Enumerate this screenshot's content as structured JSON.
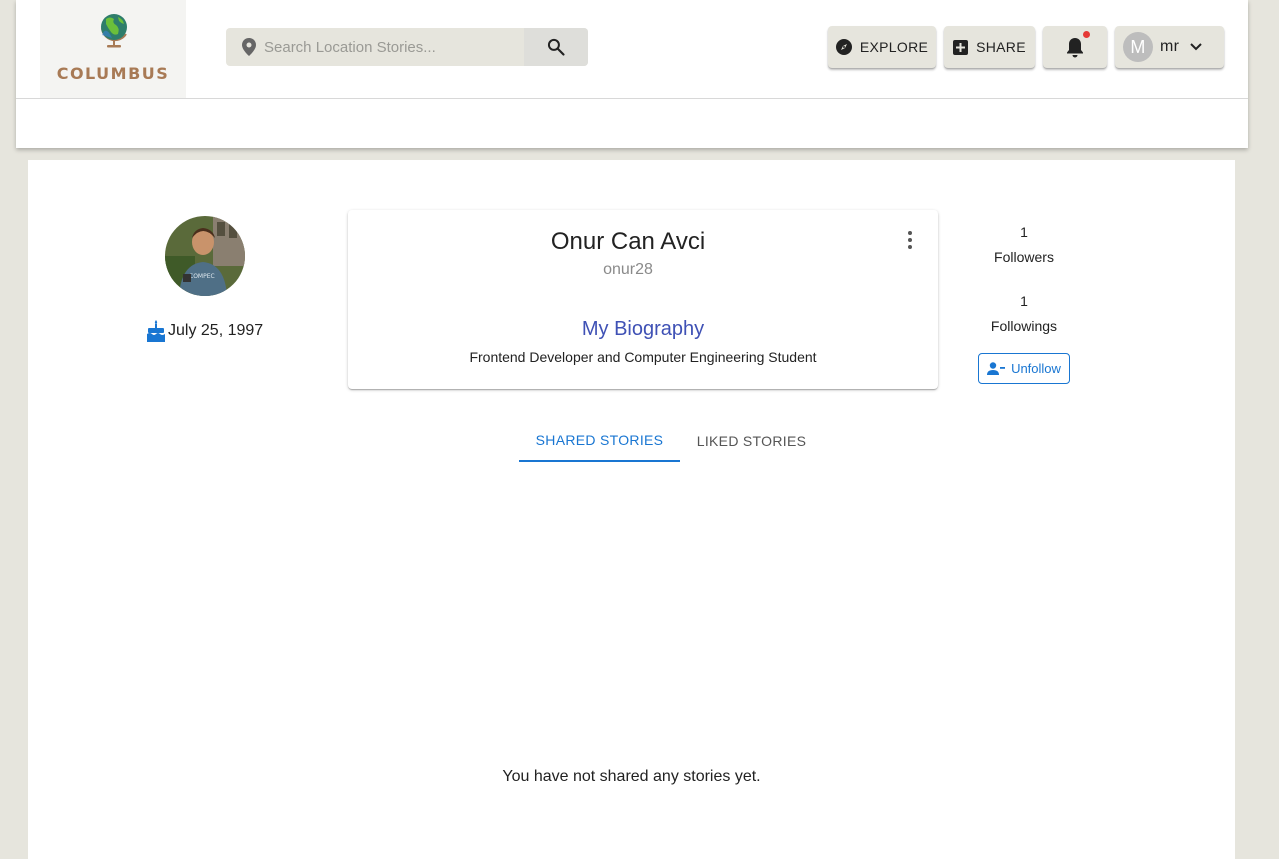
{
  "header": {
    "logo_text": "COLUMBUS",
    "search": {
      "placeholder": "Search Location Stories..."
    },
    "buttons": {
      "explore": "EXPLORE",
      "share": "SHARE"
    },
    "user": {
      "avatar_letter": "M",
      "name": "mr"
    },
    "icons": {
      "pin": "location-pin-icon",
      "search": "search-icon",
      "explore": "compass-icon",
      "share": "add-box-icon",
      "notifications": "bell-icon",
      "dropdown": "chevron-down-icon"
    }
  },
  "profile": {
    "birthday": "July 25, 1997",
    "full_name": "Onur Can Avci",
    "username": "onur28",
    "bio_title": "My Biography",
    "bio_text": "Frontend Developer and Computer Engineering Student",
    "followers_count": "1",
    "followers_label": "Followers",
    "followings_count": "1",
    "followings_label": "Followings",
    "unfollow_label": "Unfollow"
  },
  "tabs": [
    {
      "label": "SHARED STORIES",
      "active": true
    },
    {
      "label": "LIKED STORIES",
      "active": false
    }
  ],
  "empty_message": "You have not shared any stories yet.",
  "colors": {
    "background": "#e6e5dd",
    "primary": "#1976d2",
    "bio_title": "#3f51b5",
    "logo": "#a87a55",
    "notification_dot": "#e53935"
  }
}
